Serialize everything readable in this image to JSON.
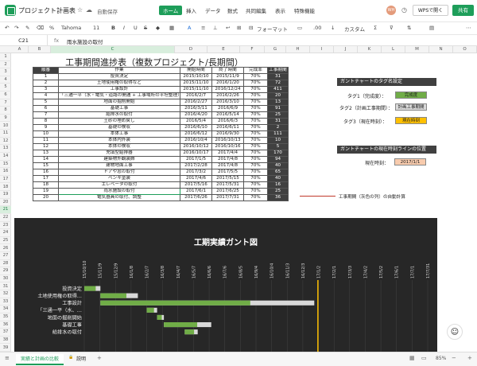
{
  "app": {
    "title": "プロジェクト計画表",
    "autosave": "自動保存"
  },
  "menu": [
    "ホーム",
    "挿入",
    "データ",
    "数式",
    "共同編集",
    "表示",
    "特殊機能"
  ],
  "header": {
    "avatar": "WH",
    "wps_button": "WPSで開く",
    "share_button": "共有"
  },
  "toolbar": {
    "font": "Tahoma",
    "size": "11",
    "format": "フォーマット",
    "custom": "カスタム"
  },
  "formula": {
    "cell": "C21",
    "fx": "fx",
    "content": "雨水施設の取付"
  },
  "columns": [
    "A",
    "B",
    "C",
    "D",
    "E",
    "F",
    "G",
    "H",
    "I",
    "J",
    "K",
    "L",
    "M",
    "N",
    "O",
    "P",
    "Q",
    "R",
    "S"
  ],
  "rows": [
    "1",
    "2",
    "3",
    "4",
    "5",
    "6",
    "7",
    "8",
    "9",
    "10",
    "11",
    "12",
    "13",
    "14",
    "15",
    "16",
    "17",
    "18",
    "19",
    "20",
    "21",
    "22",
    "23",
    "24",
    "25",
    "26",
    "27",
    "28",
    "29",
    "30",
    "31",
    "32",
    "33",
    "34",
    "35",
    "36",
    "37",
    "38",
    "39"
  ],
  "sheet": {
    "title": "工事期間進捗表（複数プロジェクト/長期間）",
    "headers": [
      "順番",
      "作業",
      "開始時間",
      "終了時間",
      "完成率",
      "工事期間"
    ],
    "tasks": [
      [
        "1",
        "投資決定",
        "2015/10/10",
        "2015/11/9",
        "70%",
        "31"
      ],
      [
        "2",
        "土地使用権の取得など",
        "2015/11/10",
        "2016/1/20",
        "70%",
        "72"
      ],
      [
        "3",
        "工事設計",
        "2015/11/10",
        "2016/12/24",
        "70%",
        "411"
      ],
      [
        "4",
        "「三通一平（水・電気・道路の開通 + 工事場所の平坦整理）」な",
        "2016/2/7",
        "2016/2/26",
        "70%",
        "20"
      ],
      [
        "5",
        "地面の掘削開始",
        "2016/2/27",
        "2016/3/10",
        "70%",
        "13"
      ],
      [
        "6",
        "基礎工事",
        "2016/3/11",
        "2016/6/9",
        "70%",
        "91"
      ],
      [
        "7",
        "給排水の取付",
        "2016/4/20",
        "2016/5/14",
        "70%",
        "25"
      ],
      [
        "8",
        "土砂の埋め戻し",
        "2016/5/4",
        "2016/6/3",
        "70%",
        "31"
      ],
      [
        "9",
        "基礎の検収",
        "2016/6/10",
        "2016/6/11",
        "70%",
        "2"
      ],
      [
        "10",
        "本体工事",
        "2016/6/12",
        "2016/9/30",
        "70%",
        "111"
      ],
      [
        "11",
        "本体内外装",
        "2016/10/4",
        "2016/10/13",
        "70%",
        "10"
      ],
      [
        "12",
        "本体の検収",
        "2016/10/12",
        "2016/10/16",
        "70%",
        "5"
      ],
      [
        "13",
        "充填型給排器",
        "2016/10/17",
        "2017/4/4",
        "70%",
        "170"
      ],
      [
        "14",
        "建築物外観装飾",
        "2017/1/5",
        "2017/4/8",
        "70%",
        "94"
      ],
      [
        "15",
        "建物地面工事",
        "2017/2/28",
        "2017/4/8",
        "70%",
        "40"
      ],
      [
        "16",
        "ドアや窓の取付",
        "2017/3/2",
        "2017/5/5",
        "70%",
        "65"
      ],
      [
        "17",
        "ベンキ塗装",
        "2017/4/6",
        "2017/5/15",
        "70%",
        "40"
      ],
      [
        "18",
        "エレベータの取付",
        "2017/5/16",
        "2017/5/31",
        "70%",
        "16"
      ],
      [
        "19",
        "雨水施設の取付",
        "2017/6/1",
        "2017/6/25",
        "70%",
        "25"
      ],
      [
        "20",
        "電気器具の取付、調整",
        "2017/6/26",
        "2017/7/31",
        "70%",
        "36"
      ]
    ]
  },
  "tags": {
    "title": "ガントチャートのタグ名設定",
    "items": [
      {
        "label": "タグ1（完成度）：",
        "value": "完成度",
        "color": "#70ad47"
      },
      {
        "label": "タグ2（計画工事期間）：",
        "value": "計画工事期間",
        "color": "#d9d9d9"
      },
      {
        "label": "タグ3（現在時刻）：",
        "value": "現在時刻",
        "color": "#ffc000"
      }
    ],
    "current_title": "ガントチャートの現在時刻ラインの位置",
    "current_label": "現在時刻：",
    "current_value": "2017/1/1"
  },
  "annotation": "工事期間（灰色の列）の自動計算",
  "chart_data": {
    "type": "bar",
    "title": "工期実績ガント図",
    "x_ticks": [
      "15/10/10",
      "15/11/9",
      "15/12/9",
      "16/1/8",
      "16/2/7",
      "16/3/8",
      "16/4/7",
      "16/5/7",
      "16/6/6",
      "16/7/6",
      "16/8/5",
      "16/9/4",
      "16/10/4",
      "16/11/3",
      "16/12/3",
      "17/1/2",
      "17/2/1",
      "17/3/3",
      "17/4/2",
      "17/5/2",
      "17/6/1",
      "17/7/1",
      "17/7/31"
    ],
    "categories": [
      "投資決定",
      "土地使用権の取得…",
      "工事設計",
      "「三通一平（水、…",
      "地面の掘削開始",
      "基礎工事",
      "給排水の取付"
    ],
    "series": [
      {
        "name": "完成度",
        "start": [
          "2015/10/10",
          "2015/11/10",
          "2015/11/10",
          "2016/2/7",
          "2016/2/27",
          "2016/3/11",
          "2016/4/20"
        ],
        "values": [
          22,
          50,
          288,
          14,
          9,
          64,
          18
        ]
      },
      {
        "name": "計画工事期間",
        "values": [
          31,
          72,
          411,
          20,
          13,
          91,
          25
        ]
      }
    ],
    "current_date": "2017/1/1",
    "x_range": [
      "2015/10/10",
      "2017/7/31"
    ],
    "colors": {
      "done": "#70ad47",
      "planned": "#d9d9d9",
      "now": "#ffc000",
      "bg": "#272727"
    }
  },
  "bottom": {
    "tabs": [
      "実績と計画の比較",
      "説明"
    ],
    "zoom": "85%"
  }
}
